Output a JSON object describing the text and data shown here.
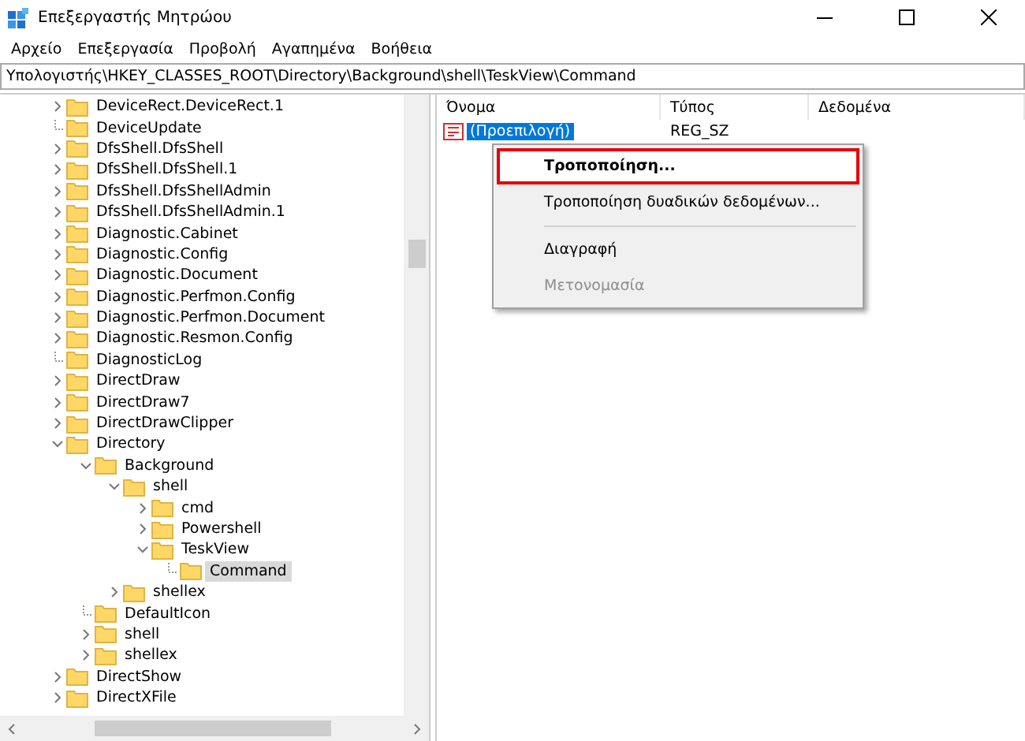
{
  "window": {
    "title": "Επεξεργαστής Μητρώου"
  },
  "menu": [
    {
      "label": "Αρχείο"
    },
    {
      "label": "Επεξεργασία"
    },
    {
      "label": "Προβολή"
    },
    {
      "label": "Αγαπημένα"
    },
    {
      "label": "Βοήθεια"
    }
  ],
  "address": "Υπολογιστής\\HKEY_CLASSES_ROOT\\Directory\\Background\\shell\\TeskView\\Command",
  "tree": [
    {
      "label": "DeviceRect.DeviceRect.1",
      "kind": "branch",
      "expanded": false,
      "selected": false
    },
    {
      "label": "DeviceUpdate",
      "kind": "leaf",
      "selected": false
    },
    {
      "label": "DfsShell.DfsShell",
      "kind": "branch",
      "expanded": false,
      "selected": false
    },
    {
      "label": "DfsShell.DfsShell.1",
      "kind": "branch",
      "expanded": false,
      "selected": false
    },
    {
      "label": "DfsShell.DfsShellAdmin",
      "kind": "branch",
      "expanded": false,
      "selected": false
    },
    {
      "label": "DfsShell.DfsShellAdmin.1",
      "kind": "branch",
      "expanded": false,
      "selected": false
    },
    {
      "label": "Diagnostic.Cabinet",
      "kind": "branch",
      "expanded": false,
      "selected": false
    },
    {
      "label": "Diagnostic.Config",
      "kind": "branch",
      "expanded": false,
      "selected": false
    },
    {
      "label": "Diagnostic.Document",
      "kind": "branch",
      "expanded": false,
      "selected": false
    },
    {
      "label": "Diagnostic.Perfmon.Config",
      "kind": "branch",
      "expanded": false,
      "selected": false
    },
    {
      "label": "Diagnostic.Perfmon.Document",
      "kind": "branch",
      "expanded": false,
      "selected": false
    },
    {
      "label": "Diagnostic.Resmon.Config",
      "kind": "branch",
      "expanded": false,
      "selected": false
    },
    {
      "label": "DiagnosticLog",
      "kind": "leaf",
      "selected": false
    },
    {
      "label": "DirectDraw",
      "kind": "branch",
      "expanded": false,
      "selected": false
    },
    {
      "label": "DirectDraw7",
      "kind": "branch",
      "expanded": false,
      "selected": false
    },
    {
      "label": "DirectDrawClipper",
      "kind": "branch",
      "expanded": false,
      "selected": false
    },
    {
      "label": "Directory",
      "kind": "branch",
      "expanded": true,
      "selected": false,
      "children": [
        {
          "label": "Background",
          "kind": "branch",
          "expanded": true,
          "selected": false,
          "children": [
            {
              "label": "shell",
              "kind": "branch",
              "expanded": true,
              "selected": false,
              "children": [
                {
                  "label": "cmd",
                  "kind": "branch",
                  "expanded": false,
                  "selected": false
                },
                {
                  "label": "Powershell",
                  "kind": "branch",
                  "expanded": false,
                  "selected": false
                },
                {
                  "label": "TeskView",
                  "kind": "branch",
                  "expanded": true,
                  "selected": false,
                  "children": [
                    {
                      "label": "Command",
                      "kind": "leaf",
                      "selected": true
                    }
                  ]
                }
              ]
            },
            {
              "label": "shellex",
              "kind": "branch",
              "expanded": false,
              "selected": false
            }
          ]
        },
        {
          "label": "DefaultIcon",
          "kind": "leaf",
          "selected": false
        },
        {
          "label": "shell",
          "kind": "branch",
          "expanded": false,
          "selected": false
        },
        {
          "label": "shellex",
          "kind": "branch",
          "expanded": false,
          "selected": false
        }
      ]
    },
    {
      "label": "DirectShow",
      "kind": "branch",
      "expanded": false,
      "selected": false
    },
    {
      "label": "DirectXFile",
      "kind": "branch",
      "expanded": false,
      "selected": false
    }
  ],
  "table": {
    "columns": [
      "Όνομα",
      "Τύπος",
      "Δεδομένα"
    ],
    "rows": [
      {
        "name": "(Προεπιλογή)",
        "type": "REG_SZ",
        "selected": true
      }
    ]
  },
  "context_menu": [
    {
      "kind": "item",
      "label": "Τροποποίηση...",
      "bold": true,
      "highlighted": true,
      "disabled": false
    },
    {
      "kind": "item",
      "label": "Τροποποίηση δυαδικών δεδομένων...",
      "bold": false,
      "highlighted": false,
      "disabled": false
    },
    {
      "kind": "separator"
    },
    {
      "kind": "item",
      "label": "Διαγραφή",
      "bold": false,
      "highlighted": false,
      "disabled": false
    },
    {
      "kind": "item",
      "label": "Μετονομασία",
      "bold": false,
      "highlighted": false,
      "disabled": true
    }
  ]
}
